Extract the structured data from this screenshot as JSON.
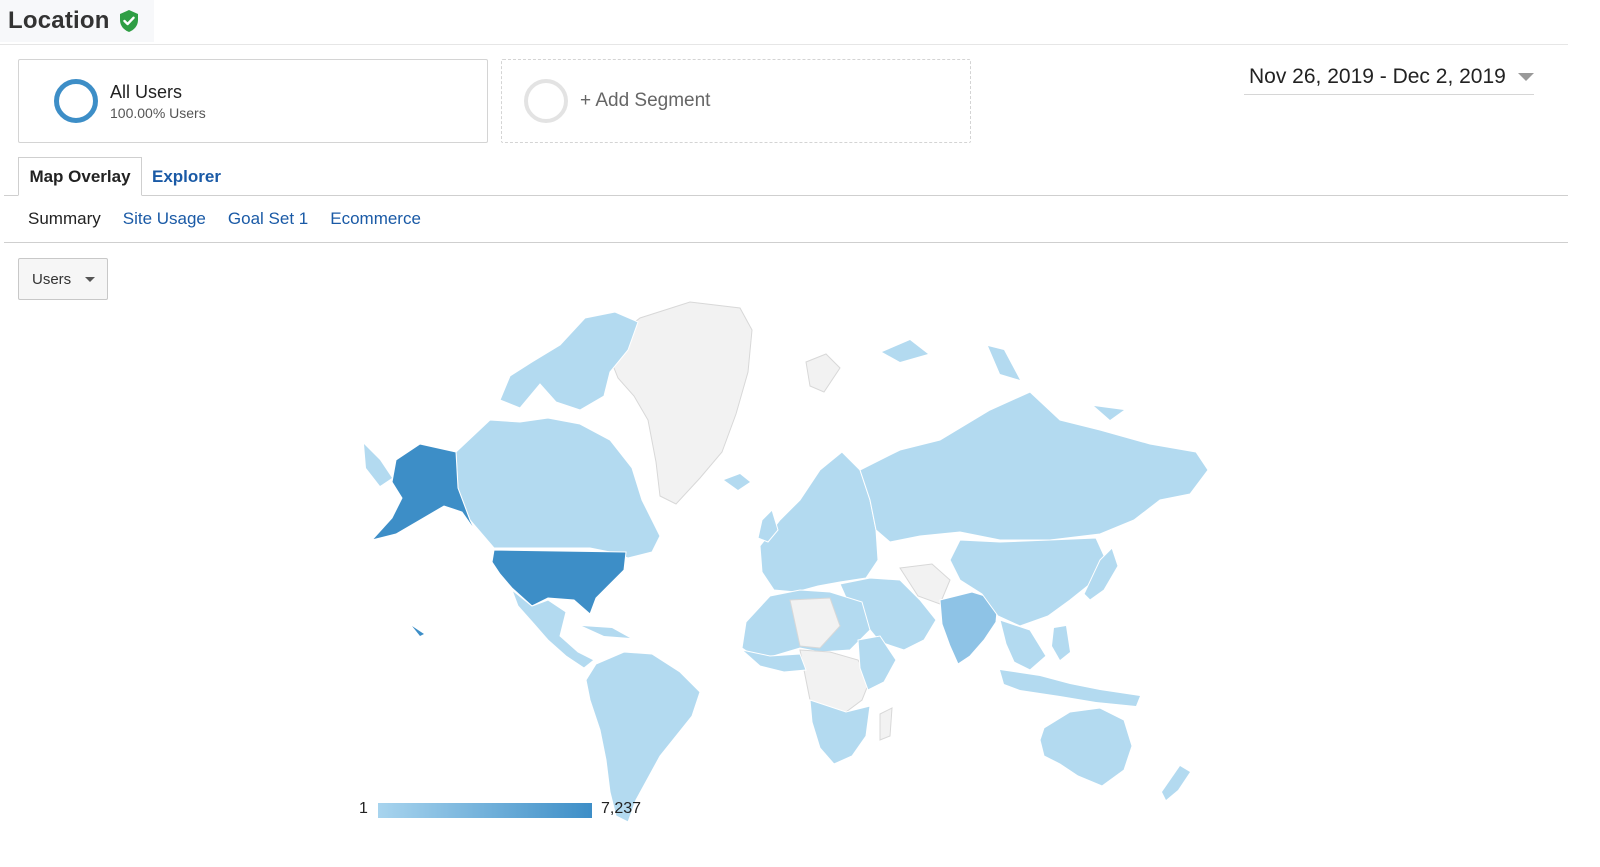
{
  "header": {
    "title": "Location",
    "verified_icon": "check-shield-icon"
  },
  "segments": {
    "all_users": {
      "name": "All Users",
      "subtitle": "100.00% Users"
    },
    "add_segment": {
      "label": "+ Add Segment"
    }
  },
  "date_range": {
    "label": "Nov 26, 2019 - Dec 2, 2019"
  },
  "tabs": [
    {
      "label": "Map Overlay",
      "active": true
    },
    {
      "label": "Explorer",
      "active": false
    }
  ],
  "subtabs": [
    {
      "label": "Summary",
      "active": true
    },
    {
      "label": "Site Usage",
      "active": false
    },
    {
      "label": "Goal Set 1",
      "active": false
    },
    {
      "label": "Ecommerce",
      "active": false
    }
  ],
  "metric_selector": {
    "selected": "Users"
  },
  "map_legend": {
    "min": "1",
    "max": "7,237"
  },
  "colors": {
    "highest": "#3d8ec7",
    "medium": "#8ec3e6",
    "low": "#b3daf0",
    "no_data": "#f2f2f2",
    "link": "#1a5aa6",
    "verified": "#2f9e44"
  }
}
